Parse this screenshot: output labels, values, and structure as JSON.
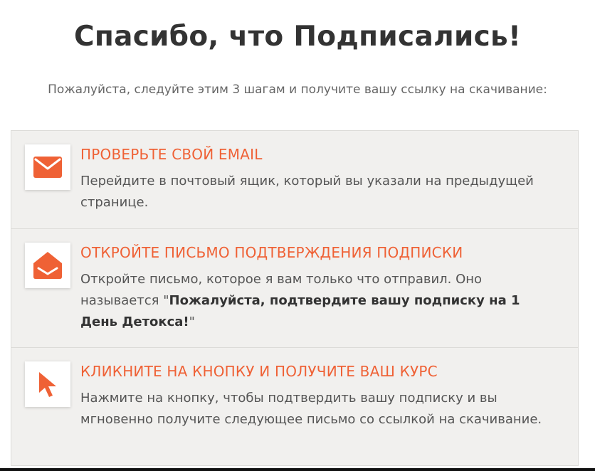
{
  "header": {
    "title": "Спасибо, что Подписались!",
    "intro": "Пожалуйста, следуйте этим 3 шагам и получите вашу ссылку на скачивание:"
  },
  "colors": {
    "accent": "#ef6135",
    "box_background": "#f1f0ee"
  },
  "steps": [
    {
      "icon": "envelope-icon",
      "title": "ПРОВЕРЬТЕ СВОЙ EMAIL",
      "text": "Перейдите в почтовый ящик, который вы указали на предыдущей странице."
    },
    {
      "icon": "open-envelope-icon",
      "title": "ОТКРОЙТЕ ПИСЬМО ПОДТВЕРЖДЕНИЯ ПОДПИСКИ",
      "text_before": "Откройте письмо, которое я вам только что отправил. Оно называется \"",
      "text_bold": "Пожалуйста, подтвердите вашу подписку на 1 День Детокса!",
      "text_after": "\""
    },
    {
      "icon": "cursor-icon",
      "title": "КЛИКНИТЕ НА КНОПКУ И ПОЛУЧИТЕ ВАШ КУРС",
      "text": "Нажмите на кнопку, чтобы подтвердить вашу подписку и вы мгновенно получите следующее письмо со ссылкой на скачивание."
    }
  ]
}
